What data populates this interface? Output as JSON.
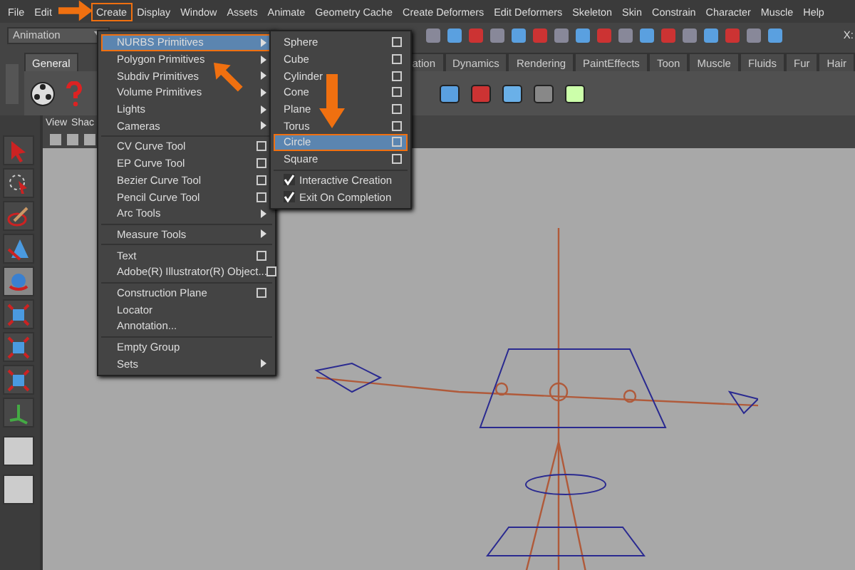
{
  "menubar": [
    {
      "label": "File",
      "selected": false
    },
    {
      "label": "Edit",
      "selected": false
    },
    {
      "label": "Create",
      "selected": true
    },
    {
      "label": "Display",
      "selected": false
    },
    {
      "label": "Window",
      "selected": false
    },
    {
      "label": "Assets",
      "selected": false
    },
    {
      "label": "Animate",
      "selected": false
    },
    {
      "label": "Geometry Cache",
      "selected": false
    },
    {
      "label": "Create Deformers",
      "selected": false
    },
    {
      "label": "Edit Deformers",
      "selected": false
    },
    {
      "label": "Skeleton",
      "selected": false
    },
    {
      "label": "Skin",
      "selected": false
    },
    {
      "label": "Constrain",
      "selected": false
    },
    {
      "label": "Character",
      "selected": false
    },
    {
      "label": "Muscle",
      "selected": false
    },
    {
      "label": "Help",
      "selected": false
    }
  ],
  "mode_dropdown": {
    "value": "Animation"
  },
  "coordinate_label": "X:",
  "shelf_tabs": [
    {
      "label": "General",
      "selected": true
    },
    {
      "label": "ation",
      "selected": false
    },
    {
      "label": "Dynamics",
      "selected": false
    },
    {
      "label": "Rendering",
      "selected": false
    },
    {
      "label": "PaintEffects",
      "selected": false
    },
    {
      "label": "Toon",
      "selected": false
    },
    {
      "label": "Muscle",
      "selected": false
    },
    {
      "label": "Fluids",
      "selected": false
    },
    {
      "label": "Fur",
      "selected": false
    },
    {
      "label": "Hair",
      "selected": false
    }
  ],
  "panel_menu": [
    "View",
    "Shac"
  ],
  "create_menu": [
    [
      {
        "label": "NURBS Primitives",
        "kind": "submenu",
        "selected": true
      },
      {
        "label": "Polygon Primitives",
        "kind": "submenu",
        "selected": false
      },
      {
        "label": "Subdiv Primitives",
        "kind": "submenu",
        "selected": false
      },
      {
        "label": "Volume Primitives",
        "kind": "submenu",
        "selected": false
      },
      {
        "label": "Lights",
        "kind": "submenu",
        "selected": false
      },
      {
        "label": "Cameras",
        "kind": "submenu",
        "selected": false
      }
    ],
    [
      {
        "label": "CV Curve Tool",
        "kind": "option",
        "selected": false
      },
      {
        "label": "EP Curve Tool",
        "kind": "option",
        "selected": false
      },
      {
        "label": "Bezier Curve Tool",
        "kind": "option",
        "selected": false
      },
      {
        "label": "Pencil Curve Tool",
        "kind": "option",
        "selected": false
      },
      {
        "label": "Arc Tools",
        "kind": "submenu",
        "selected": false
      }
    ],
    [
      {
        "label": "Measure Tools",
        "kind": "submenu",
        "selected": false
      }
    ],
    [
      {
        "label": "Text",
        "kind": "option",
        "selected": false
      },
      {
        "label": "Adobe(R) Illustrator(R) Object...",
        "kind": "option",
        "selected": false
      }
    ],
    [
      {
        "label": "Construction Plane",
        "kind": "option",
        "selected": false
      },
      {
        "label": "Locator",
        "kind": "plain",
        "selected": false
      },
      {
        "label": "Annotation...",
        "kind": "plain",
        "selected": false
      }
    ],
    [
      {
        "label": "Empty Group",
        "kind": "plain",
        "selected": false
      },
      {
        "label": "Sets",
        "kind": "submenu",
        "selected": false
      }
    ]
  ],
  "nurbs_submenu": [
    [
      {
        "label": "Sphere",
        "kind": "option",
        "selected": false
      },
      {
        "label": "Cube",
        "kind": "option",
        "selected": false
      },
      {
        "label": "Cylinder",
        "kind": "option",
        "selected": false
      },
      {
        "label": "Cone",
        "kind": "option",
        "selected": false
      },
      {
        "label": "Plane",
        "kind": "option",
        "selected": false
      },
      {
        "label": "Torus",
        "kind": "option",
        "selected": false
      },
      {
        "label": "Circle",
        "kind": "option",
        "selected": true
      },
      {
        "label": "Square",
        "kind": "option",
        "selected": false
      }
    ],
    [
      {
        "label": "Interactive Creation",
        "kind": "check",
        "checked": true,
        "selected": false
      },
      {
        "label": "Exit On Completion",
        "kind": "check",
        "checked": true,
        "selected": false
      }
    ]
  ]
}
